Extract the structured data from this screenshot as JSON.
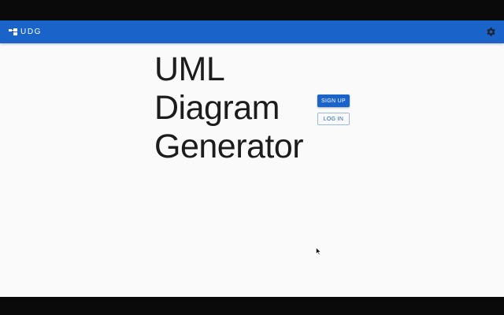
{
  "appbar": {
    "brand_text": "UDG",
    "brand_icon": "logo-blocks-icon",
    "settings_icon": "gear-icon",
    "color": "#1a63c9"
  },
  "hero": {
    "title_lines": [
      "UML",
      "Diagram",
      "Generator"
    ]
  },
  "actions": {
    "signup_label": "SIGN UP",
    "login_label": "LOG IN"
  },
  "colors": {
    "primary": "#1a63c9",
    "background": "#fafafa",
    "title_text": "#1c1c1c"
  }
}
